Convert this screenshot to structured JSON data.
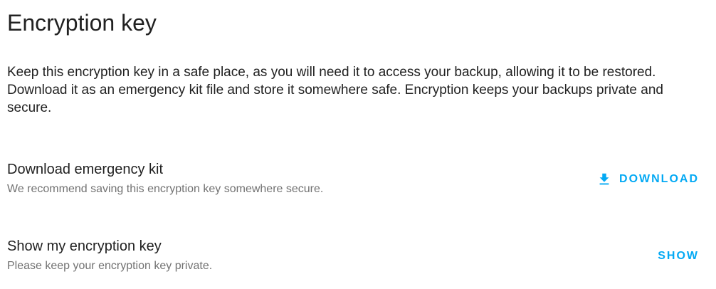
{
  "title": "Encryption key",
  "description": "Keep this encryption key in a safe place, as you will need it to access your backup, allowing it to be restored. Download it as an emergency kit file and store it somewhere safe. Encryption keeps your backups private and secure.",
  "accent_color": "#03a9f4",
  "rows": [
    {
      "heading": "Download emergency kit",
      "subtext": "We recommend saving this encryption key somewhere secure.",
      "action_label": "DOWNLOAD",
      "action_icon": "download-icon"
    },
    {
      "heading": "Show my encryption key",
      "subtext": "Please keep your encryption key private.",
      "action_label": "SHOW"
    }
  ]
}
